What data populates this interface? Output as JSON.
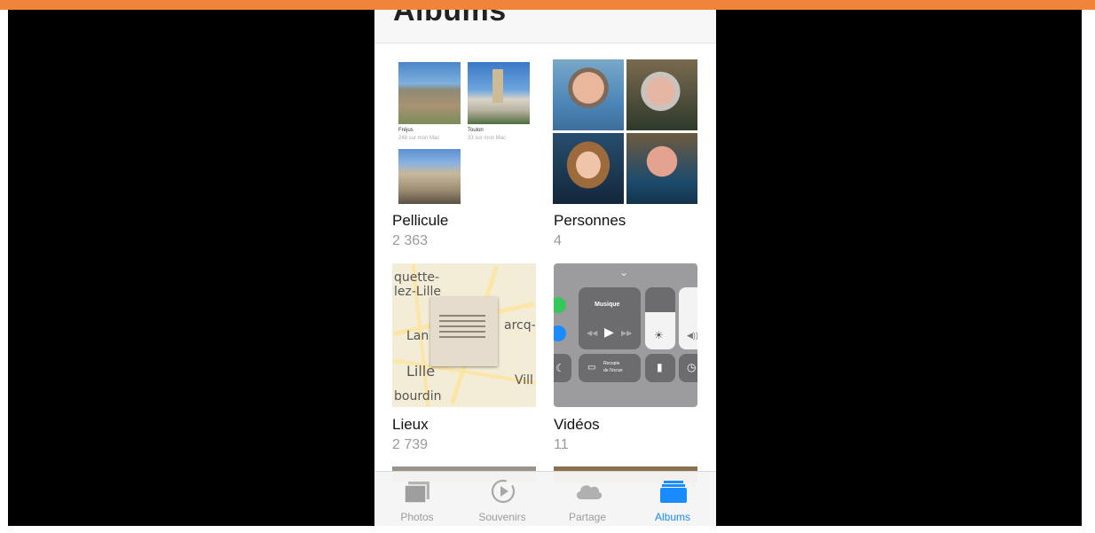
{
  "header": {
    "title": "Albums"
  },
  "albums": [
    {
      "title": "Pellicule",
      "count": "2 363"
    },
    {
      "title": "Personnes",
      "count": "4"
    },
    {
      "title": "Lieux",
      "count": "2 739"
    },
    {
      "title": "Vidéos",
      "count": "11"
    }
  ],
  "pellicule_subalbums": [
    {
      "name": "Fréjus",
      "detail": "248 sur mon Mac"
    },
    {
      "name": "Toulon",
      "detail": "33 sur mon Mac"
    }
  ],
  "map_labels": [
    "quette-",
    "lez-Lille",
    "Lan",
    "arcq-",
    "Lille",
    "Vill",
    "bourdin"
  ],
  "control_center": {
    "music_label": "Musique",
    "mirror_label_line1": "Recopie",
    "mirror_label_line2": "de l'écran"
  },
  "tabbar": {
    "items": [
      {
        "label": "Photos",
        "icon": "photos-icon",
        "active": false
      },
      {
        "label": "Souvenirs",
        "icon": "memories-icon",
        "active": false
      },
      {
        "label": "Partage",
        "icon": "cloud-icon",
        "active": false
      },
      {
        "label": "Albums",
        "icon": "albums-icon",
        "active": true
      }
    ]
  },
  "colors": {
    "top_bar": "#f0843a",
    "active_tab": "#1a8cff",
    "inactive_tab": "#9c9c9c"
  }
}
